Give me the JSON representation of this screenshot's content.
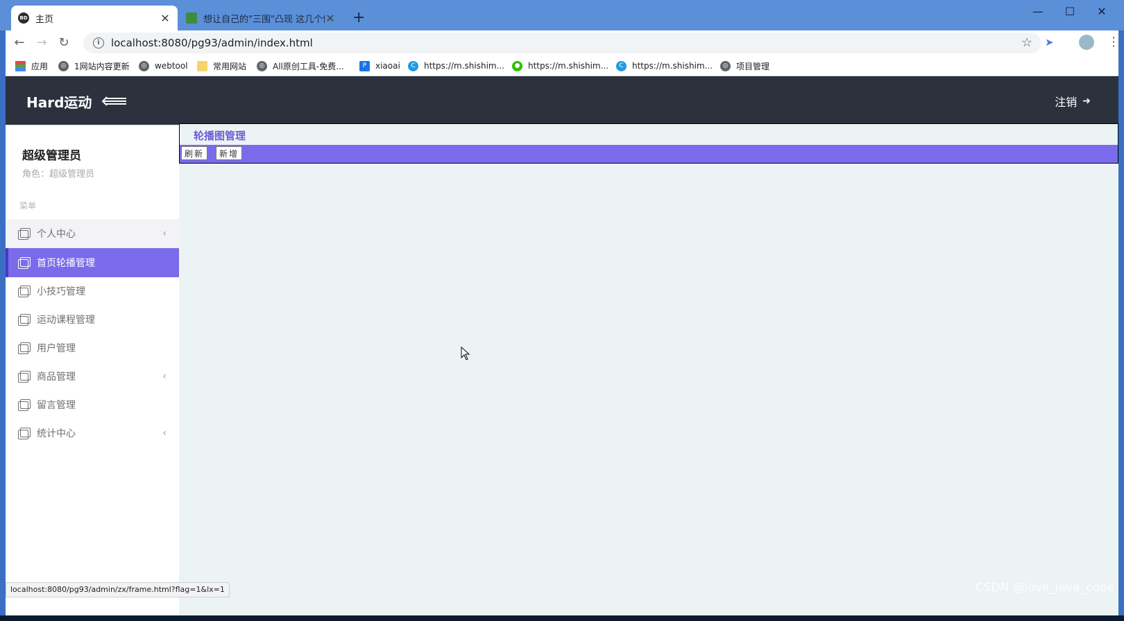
{
  "browser": {
    "tabs": [
      {
        "label": "主页",
        "favicon": "BD"
      },
      {
        "label": "想让自己的\"三围\"凸现 这几个健..."
      }
    ],
    "url": "localhost:8080/pg93/admin/index.html",
    "status_url": "localhost:8080/pg93/admin/zx/frame.html?flag=1&lx=1",
    "bookmarks": [
      {
        "label": "应用",
        "icon": "apps-grid-icon"
      },
      {
        "label": "1网站内容更新",
        "icon": "globe-icon"
      },
      {
        "label": "webtool",
        "icon": "globe-icon"
      },
      {
        "label": "常用网站",
        "icon": "folder-icon"
      },
      {
        "label": "All原创工具-免费...",
        "icon": "globe-icon"
      },
      {
        "label": "xiaoai",
        "icon": "p-icon"
      },
      {
        "label": "https://m.shishim...",
        "icon": "c-icon"
      },
      {
        "label": "https://m.shishim...",
        "icon": "wechat-icon"
      },
      {
        "label": "https://m.shishim...",
        "icon": "c-icon"
      },
      {
        "label": "项目管理",
        "icon": "globe-icon"
      }
    ]
  },
  "app": {
    "brand": "Hard运动",
    "logout": "注销"
  },
  "user": {
    "name": "超级管理员",
    "role": "角色：超级管理员"
  },
  "sidebar": {
    "heading": "菜单",
    "items": [
      {
        "label": "个人中心",
        "has_submenu": true
      },
      {
        "label": "首页轮播管理",
        "active": true
      },
      {
        "label": "小技巧管理"
      },
      {
        "label": "运动课程管理"
      },
      {
        "label": "用户管理"
      },
      {
        "label": "商品管理",
        "has_submenu": true
      },
      {
        "label": "留言管理"
      },
      {
        "label": "统计中心",
        "has_submenu": true
      }
    ]
  },
  "content": {
    "title": "轮播图管理",
    "refresh_label": "刷新",
    "add_label": "新增"
  },
  "watermark": "CSDN @love_java_code",
  "colors": {
    "header_bg": "#2b313d",
    "accent": "#7b6bea",
    "content_bg": "#ecf3f4"
  }
}
